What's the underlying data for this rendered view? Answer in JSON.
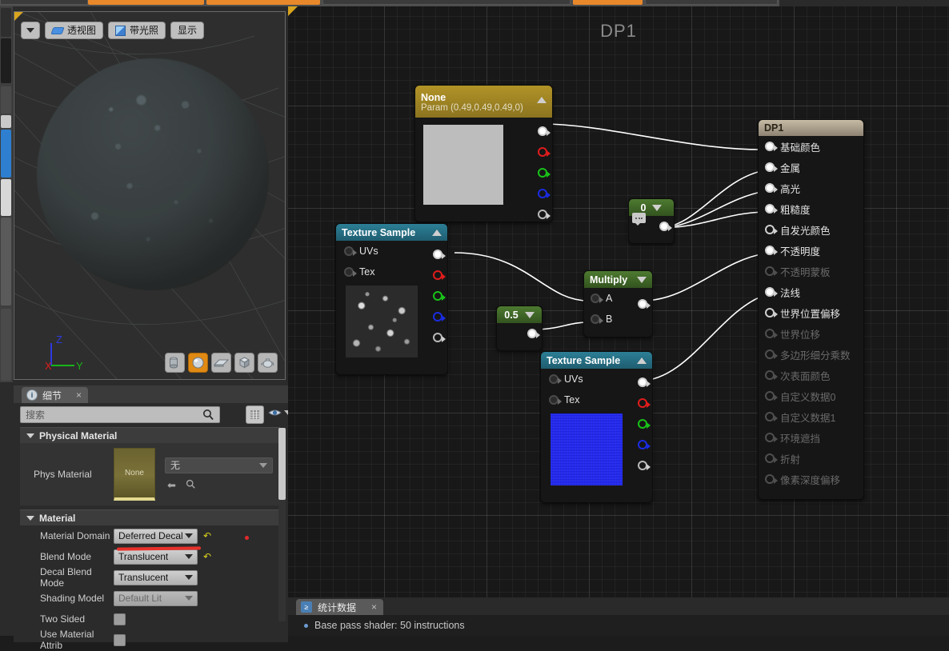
{
  "app": {
    "graph_title": "DP1"
  },
  "toolbar_strip": {
    "buttons": [
      "",
      "",
      "",
      ""
    ]
  },
  "viewport": {
    "dropdown_label": "",
    "view_mode_label": "透视图",
    "lighting_label": "带光照",
    "show_label": "显示",
    "gizmo": {
      "x": "X",
      "y": "Y",
      "z": "Z"
    },
    "shapes": [
      {
        "name": "cylinder",
        "active": false
      },
      {
        "name": "sphere",
        "active": true
      },
      {
        "name": "plane",
        "active": false
      },
      {
        "name": "cube",
        "active": false
      },
      {
        "name": "teapot",
        "active": false
      }
    ]
  },
  "details": {
    "tab_label": "细节",
    "close_label": "×",
    "search_placeholder": "搜索",
    "sections": [
      {
        "title": "Physical Material",
        "rows": [
          {
            "label": "Phys Material",
            "thumb_text": "None",
            "value": "无",
            "type": "asset"
          }
        ]
      },
      {
        "title": "Material",
        "rows": [
          {
            "label": "Material Domain",
            "value": "Deferred Decal",
            "type": "combo",
            "reset": true,
            "disabled": false
          },
          {
            "label": "Blend Mode",
            "value": "Translucent",
            "type": "combo",
            "reset": true,
            "disabled": false
          },
          {
            "label": "Decal Blend Mode",
            "value": "Translucent",
            "type": "combo",
            "reset": false,
            "disabled": false
          },
          {
            "label": "Shading Model",
            "value": "Default Lit",
            "type": "combo",
            "reset": false,
            "disabled": true
          },
          {
            "label": "Two Sided",
            "value": "",
            "type": "checkbox",
            "reset": false,
            "disabled": false
          },
          {
            "label": "Use Material Attrib",
            "value": "",
            "type": "checkbox",
            "reset": false,
            "disabled": false
          }
        ]
      }
    ]
  },
  "graph": {
    "nodes": [
      {
        "id": "param-none",
        "title": "None",
        "subtitle": "Param (0.49,0.49,0.49,0)",
        "header_style": "gold",
        "outputs": [
          "",
          "",
          "",
          "",
          ""
        ]
      },
      {
        "id": "texture-sample-1",
        "title": "Texture Sample",
        "header_style": "teal",
        "inputs": [
          "UVs",
          "Tex"
        ],
        "outputs": [
          "",
          "",
          "",
          "",
          ""
        ]
      },
      {
        "id": "texture-sample-2",
        "title": "Texture Sample",
        "header_style": "teal",
        "inputs": [
          "UVs",
          "Tex"
        ],
        "outputs": [
          "",
          "",
          "",
          "",
          ""
        ]
      },
      {
        "id": "const-zero",
        "title": "0",
        "header_style": "green"
      },
      {
        "id": "const-half",
        "title": "0.5",
        "header_style": "green"
      },
      {
        "id": "multiply",
        "title": "Multiply",
        "header_style": "green",
        "inputs": [
          "A",
          "B"
        ]
      },
      {
        "id": "material-output",
        "title": "DP1",
        "header_style": "tan",
        "pins": [
          {
            "label": "基础颜色",
            "enabled": true,
            "connected": true
          },
          {
            "label": "金属",
            "enabled": true,
            "connected": true
          },
          {
            "label": "高光",
            "enabled": true,
            "connected": true
          },
          {
            "label": "粗糙度",
            "enabled": true,
            "connected": true
          },
          {
            "label": "自发光颜色",
            "enabled": true,
            "connected": false
          },
          {
            "label": "不透明度",
            "enabled": true,
            "connected": true
          },
          {
            "label": "不透明蒙板",
            "enabled": false,
            "connected": false
          },
          {
            "label": "法线",
            "enabled": true,
            "connected": true
          },
          {
            "label": "世界位置偏移",
            "enabled": true,
            "connected": false
          },
          {
            "label": "世界位移",
            "enabled": false,
            "connected": false
          },
          {
            "label": "多边形细分乘数",
            "enabled": false,
            "connected": false
          },
          {
            "label": "次表面颜色",
            "enabled": false,
            "connected": false
          },
          {
            "label": "自定义数据0",
            "enabled": false,
            "connected": false
          },
          {
            "label": "自定义数据1",
            "enabled": false,
            "connected": false
          },
          {
            "label": "环境遮挡",
            "enabled": false,
            "connected": false
          },
          {
            "label": "折射",
            "enabled": false,
            "connected": false
          },
          {
            "label": "像素深度偏移",
            "enabled": false,
            "connected": false
          }
        ]
      }
    ]
  },
  "stats": {
    "tab_label": "统计数据",
    "close_label": "×",
    "lines": [
      "Base pass shader: 50 instructions"
    ]
  }
}
